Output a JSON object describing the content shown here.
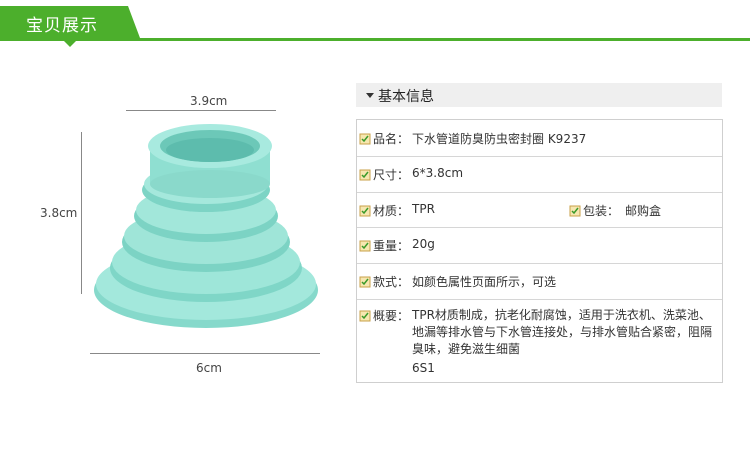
{
  "header": {
    "title": "宝贝展示"
  },
  "product_image": {
    "width_label": "3.9cm",
    "height_label": "3.8cm",
    "base_label": "6cm",
    "colors": {
      "seal": "#8fe0d2",
      "seal_dark": "#6fcfc0"
    }
  },
  "info": {
    "section_title": "基本信息",
    "rows": [
      {
        "label": "品名：",
        "value": "下水管道防臭防虫密封圈 K9237"
      },
      {
        "label": "尺寸：",
        "value": "6*3.8cm"
      },
      {
        "label": "材质：",
        "value": "TPR",
        "label2": "包装：",
        "value2": "邮购盒"
      },
      {
        "label": "重量：",
        "value": "20g"
      },
      {
        "label": "款式：",
        "value": "如颜色属性页面所示，可选"
      },
      {
        "label": "概要：",
        "value": "TPR材质制成，抗老化耐腐蚀，适用于洗衣机、洗菜池、地漏等排水管与下水管连接处，与排水管贴合紧密，阻隔臭味，避免滋生细菌",
        "code": "6S1"
      }
    ]
  },
  "colors": {
    "accent": "#4caf2c",
    "label_icon": "#c8a04a"
  }
}
